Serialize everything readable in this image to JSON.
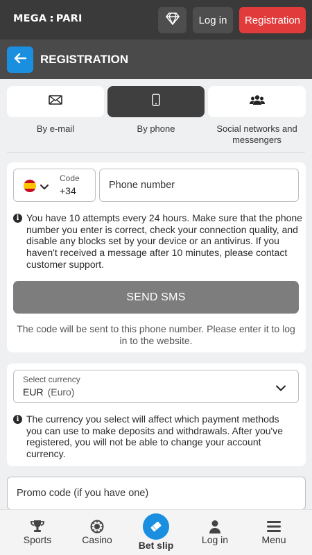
{
  "header": {
    "logo_left": "MEGA",
    "logo_right": "PARI",
    "login_label": "Log in",
    "registration_label": "Registration"
  },
  "titlebar": {
    "title": "REGISTRATION"
  },
  "tabs": [
    {
      "label": "By e-mail",
      "icon": "envelope-icon",
      "active": false
    },
    {
      "label": "By phone",
      "icon": "phone-icon",
      "active": true
    },
    {
      "label": "Social networks and messengers",
      "icon": "people-icon",
      "active": false
    }
  ],
  "phone": {
    "code_label": "Code",
    "code_value": "+34",
    "country_flag": "spain-flag",
    "placeholder": "Phone number",
    "info": "You have 10 attempts every 24 hours. Make sure that the phone number you enter is correct, check your connection quality, and disable any blocks set by your device or an antivirus. If you haven't received a message after 10 minutes, please contact customer support.",
    "send_label": "SEND SMS",
    "note": "The code will be sent to this phone number. Please enter it to log in to the website."
  },
  "currency": {
    "label": "Select currency",
    "code": "EUR",
    "name": "(Euro)",
    "info": "The currency you select will affect which payment methods you can use to make deposits and withdrawals. After you've registered, you will not be able to change your account currency."
  },
  "promo": {
    "placeholder": "Promo code (if you have one)"
  },
  "bottom_nav": [
    {
      "label": "Sports",
      "icon": "trophy-icon"
    },
    {
      "label": "Casino",
      "icon": "casino-chip-icon"
    },
    {
      "label": "Bet slip",
      "icon": "ticket-icon"
    },
    {
      "label": "Log in",
      "icon": "user-icon"
    },
    {
      "label": "Menu",
      "icon": "hamburger-icon"
    }
  ],
  "colors": {
    "accent_blue": "#1a8fe0",
    "registration_red": "#e23b3b",
    "header_dark": "#3a3a3a",
    "button_disabled": "#7d7d7d"
  }
}
